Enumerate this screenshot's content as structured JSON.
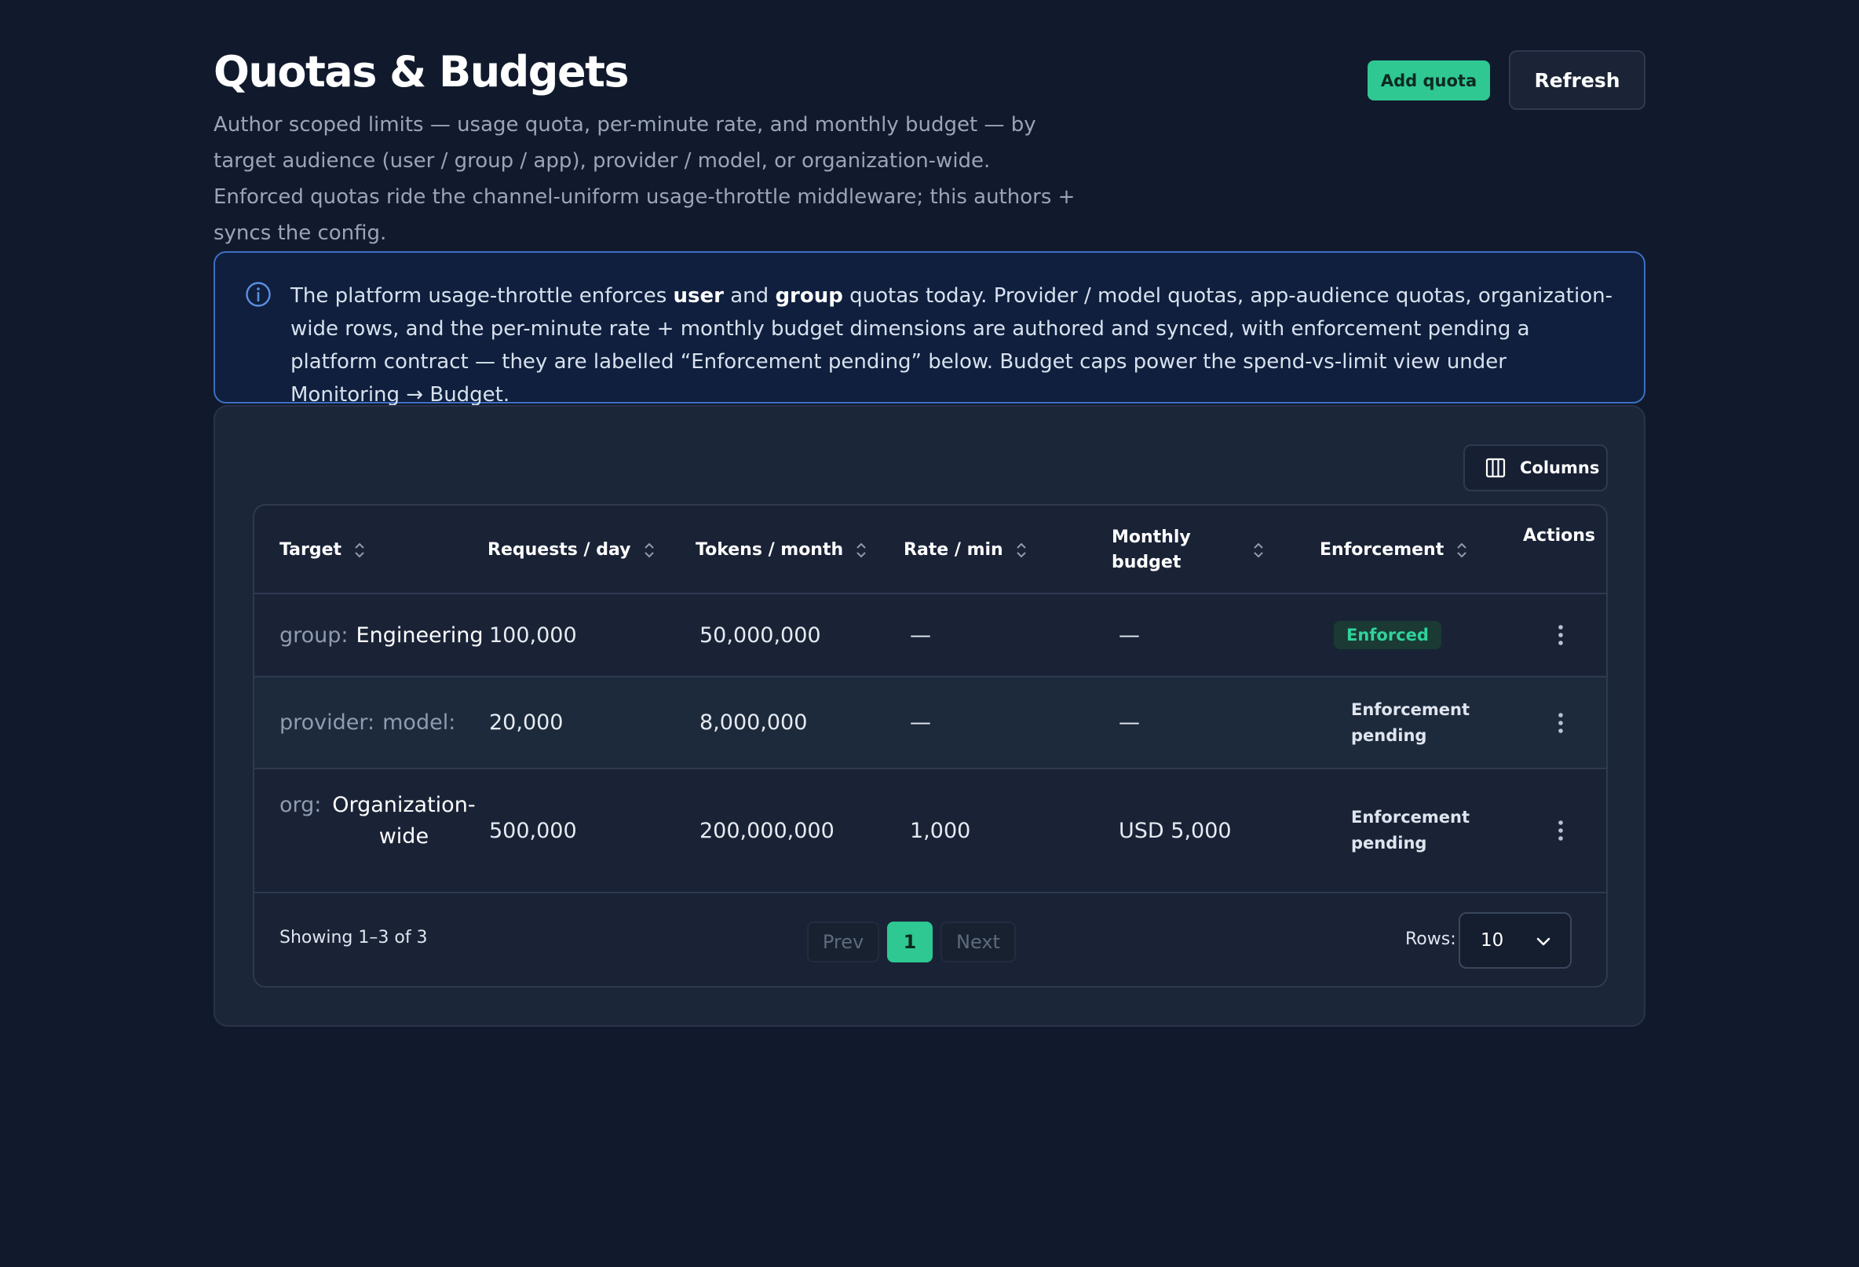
{
  "header": {
    "title": "Quotas & Budgets",
    "description": "Author scoped limits — usage quota, per-minute rate, and monthly budget — by target audience (user / group / app), provider / model, or organization-wide. Enforced quotas ride the channel-uniform usage-throttle middleware; this authors + syncs the config.",
    "add_quota_label": "Add quota",
    "refresh_label": "Refresh"
  },
  "banner": {
    "icon": "info-icon",
    "text_1": "The platform usage-throttle enforces ",
    "bold_1": "user",
    "text_2": " and ",
    "bold_2": "group",
    "text_3": " quotas today. Provider / model quotas, app-audience quotas, organization-wide rows, and the per-minute rate + monthly budget dimensions are authored and synced, with enforcement pending a platform contract — they are labelled “Enforcement pending” below. Budget caps power the spend-vs-limit view under Monitoring → Budget."
  },
  "toolbar": {
    "columns_label": "Columns",
    "columns_icon": "columns-icon"
  },
  "table": {
    "headers": {
      "target": "Target",
      "requests_day": "Requests / day",
      "tokens_month": "Tokens / month",
      "rate_min": "Rate / min",
      "monthly_budget": "Monthly budget",
      "enforcement": "Enforcement",
      "actions": "Actions"
    },
    "rows": [
      {
        "target_kind": "group:",
        "target_name": "Engineering",
        "requests_day": "100,000",
        "tokens_month": "50,000,000",
        "rate_min": "—",
        "monthly_budget": "—",
        "enforcement": "Enforced"
      },
      {
        "target_kind": "provider:",
        "target_name": "model:",
        "requests_day": "20,000",
        "tokens_month": "8,000,000",
        "rate_min": "—",
        "monthly_budget": "—",
        "enforcement": "Enforcement pending"
      },
      {
        "target_kind": "org:",
        "target_name": "Organization-wide",
        "requests_day": "500,000",
        "tokens_month": "200,000,000",
        "rate_min": "1,000",
        "monthly_budget": "USD 5,000",
        "enforcement": "Enforcement pending"
      }
    ]
  },
  "pagination": {
    "showing": "Showing 1–3 of 3",
    "prev_label": "Prev",
    "current_page": "1",
    "next_label": "Next",
    "rows_label": "Rows:",
    "rows_value": "10"
  },
  "colors": {
    "background": "#111a2c",
    "accent": "#2fc893",
    "banner_border": "#3d6fc4",
    "enforced": "#2fd39b"
  }
}
